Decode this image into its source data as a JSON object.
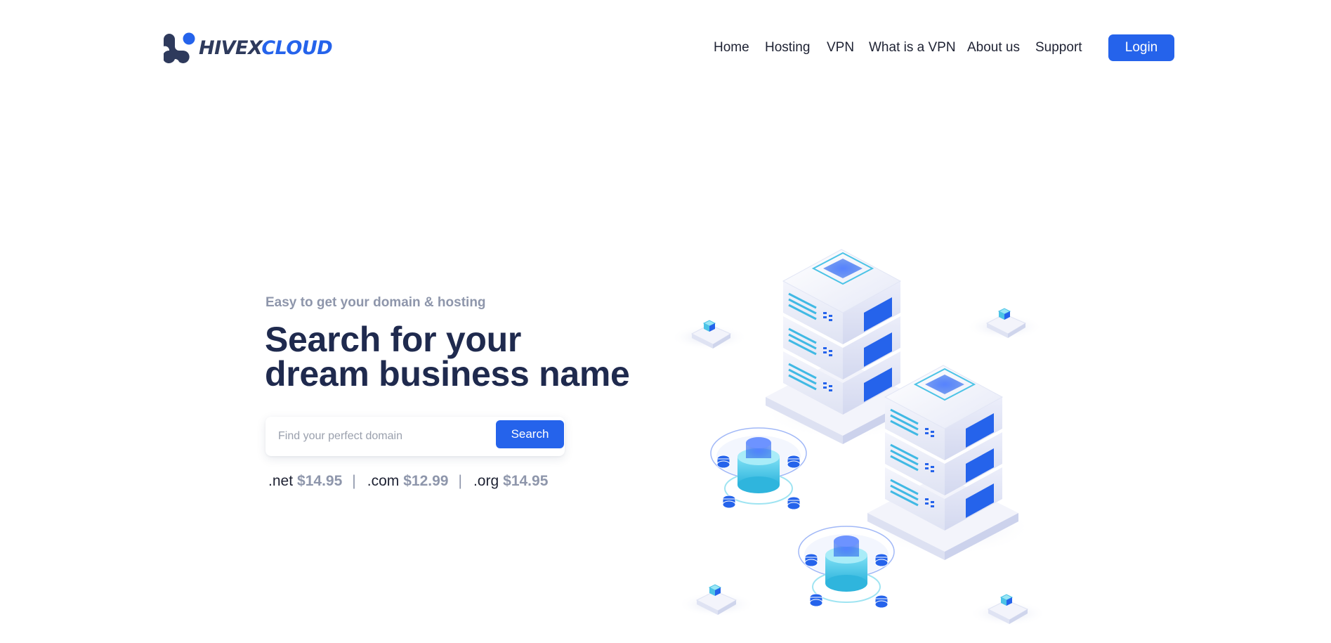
{
  "header": {
    "logo": {
      "part1": "HIVEX",
      "part2": "CLOUD",
      "icon": "hivexcloud-logo-icon"
    },
    "nav": [
      {
        "label": "Home"
      },
      {
        "label": "Hosting"
      },
      {
        "label": "VPN"
      },
      {
        "label": "What is a VPN"
      },
      {
        "label": "About us"
      },
      {
        "label": "Support"
      }
    ],
    "login_label": "Login"
  },
  "hero": {
    "eyebrow": "Easy to get your domain & hosting",
    "headline": "Search for your dream business name",
    "search": {
      "placeholder": "Find your perfect domain",
      "value": "",
      "button_label": "Search"
    },
    "prices": [
      {
        "tld": ".net",
        "price": "$14.95"
      },
      {
        "tld": ".com",
        "price": "$12.99"
      },
      {
        "tld": ".org",
        "price": "$14.95"
      }
    ],
    "separator": "|",
    "illustration": "isometric-server-racks-illustration"
  },
  "colors": {
    "brand_blue": "#2563eb",
    "heading_navy": "#1f2a4e",
    "muted_gray": "#8e96ab",
    "logo_dark": "#2e3a5c"
  }
}
